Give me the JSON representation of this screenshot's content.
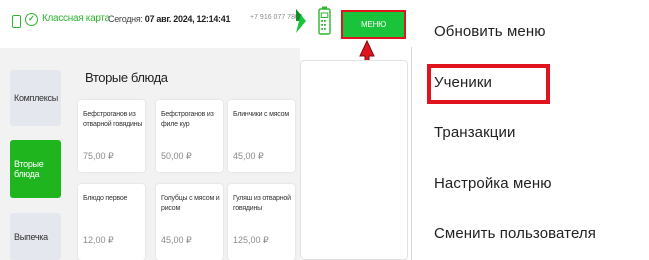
{
  "app": {
    "brand": "Классная карта",
    "today_label": "Сегодня:",
    "today_value": "07 авг. 2024, 12:14:41",
    "phone": "+7 916 077 7803",
    "menu_button": "МЕНЮ",
    "accent_color": "#19c43a",
    "highlight_color": "#e2141b"
  },
  "categories": [
    {
      "label": "Комплексы",
      "active": false
    },
    {
      "label": "Вторые блюда",
      "active": true
    },
    {
      "label": "Выпечка",
      "active": false
    }
  ],
  "section_title": "Вторые блюда",
  "dishes": [
    {
      "name": "Бефстроганов из отварной говядины",
      "price": "75,00 ₽"
    },
    {
      "name": "Бефстроганов из филе кур",
      "price": "50,00 ₽"
    },
    {
      "name": "Блинчики с мясом",
      "price": "45,00 ₽"
    },
    {
      "name": "Блюдо первое",
      "price": "12,00 ₽"
    },
    {
      "name": "Голубцы с мясом и рисом",
      "price": "45,00 ₽"
    },
    {
      "name": "Гуляш из отварной говядины",
      "price": "125,00 ₽"
    }
  ],
  "dropdown": {
    "items": [
      {
        "label": "Обновить меню"
      },
      {
        "label": "Ученики",
        "highlighted": true
      },
      {
        "label": "Транзакции"
      },
      {
        "label": "Настройка меню"
      },
      {
        "label": "Сменить пользователя"
      }
    ]
  }
}
